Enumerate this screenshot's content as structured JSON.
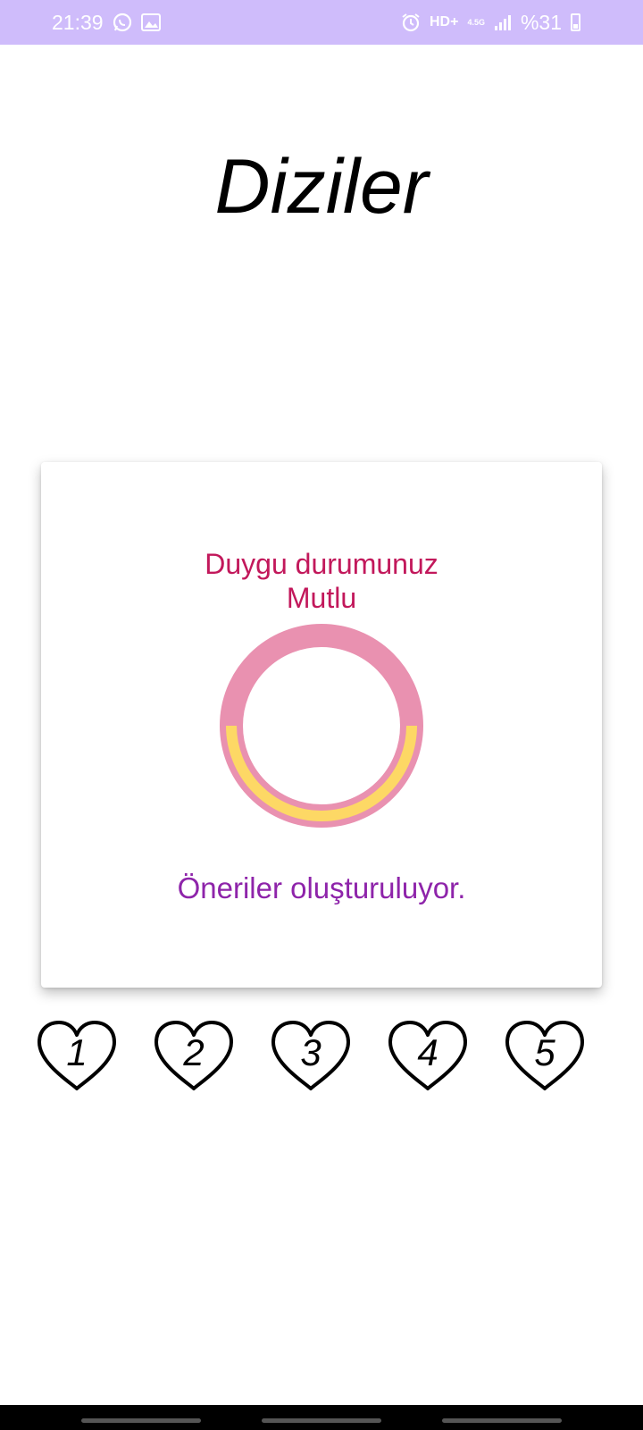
{
  "status_bar": {
    "time": "21:39",
    "network_label": "HD+",
    "network_type": "4.5G",
    "battery": "%31",
    "background": "#cfbcfb",
    "left_icons": [
      "whatsapp-icon",
      "gallery-icon"
    ],
    "right_icons": [
      "alarm-icon",
      "signal-icon",
      "battery-icon"
    ]
  },
  "page": {
    "title": "Diziler"
  },
  "card": {
    "mood_line1": "Duygu durumunuz",
    "mood_line2": "Mutlu",
    "loading_text": "Öneriler oluşturuluyor.",
    "ring_track_color": "#e991b0",
    "ring_progress_color": "#fdd865",
    "mood_color": "#c2185b",
    "loading_color": "#8e24aa"
  },
  "rating": {
    "hearts": [
      {
        "label": "1"
      },
      {
        "label": "2"
      },
      {
        "label": "3"
      },
      {
        "label": "4"
      },
      {
        "label": "5"
      }
    ]
  }
}
